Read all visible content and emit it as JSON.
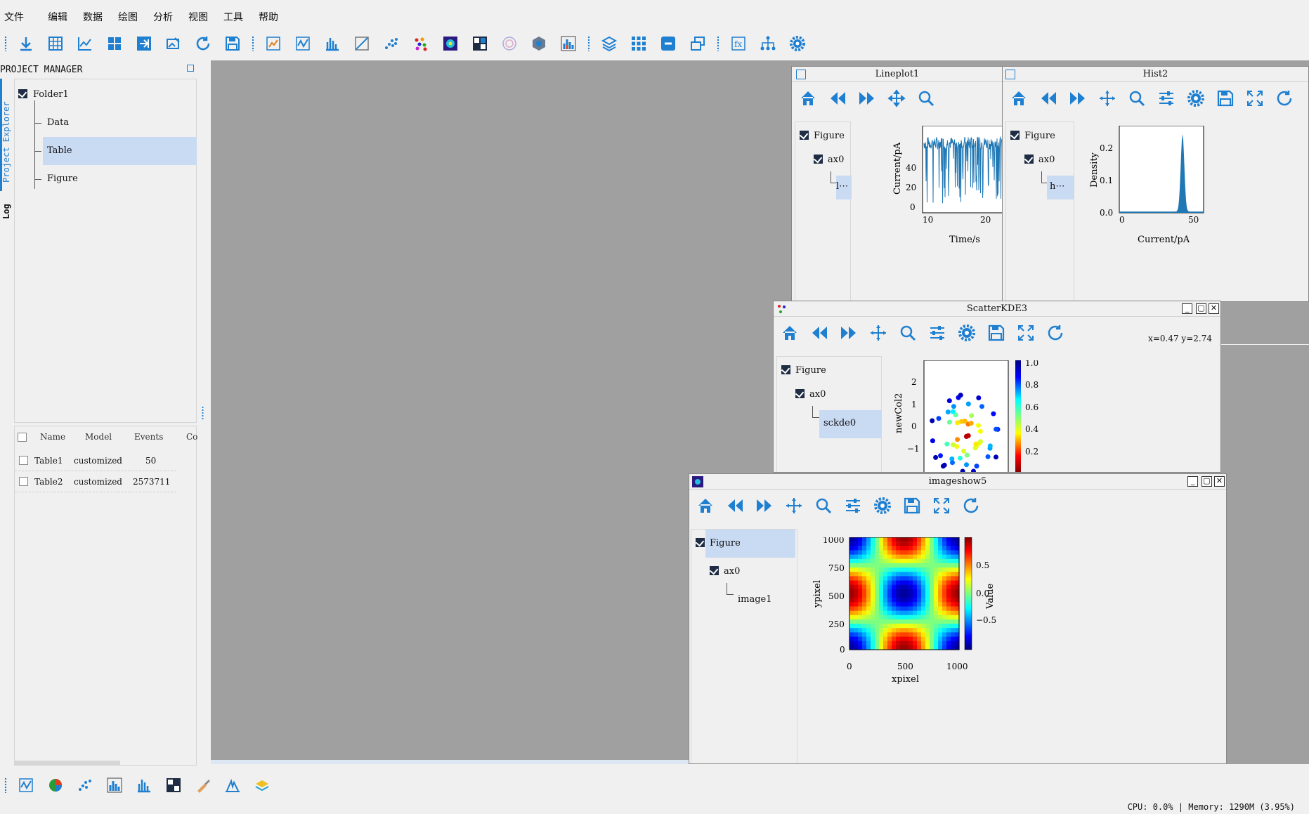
{
  "menu": [
    "文件",
    "编辑",
    "数据",
    "绘图",
    "分析",
    "视图",
    "工具",
    "帮助"
  ],
  "project_manager": {
    "title": "PROJECT MANAGER",
    "tabs": [
      "Project Explorer",
      "Log"
    ],
    "tree": {
      "root": "Folder1",
      "children": [
        "Data",
        "Table",
        "Figure"
      ],
      "selected": "Table"
    }
  },
  "table": {
    "headers": [
      "Name",
      "Model",
      "Events",
      "Co"
    ],
    "rows": [
      {
        "name": "Table1",
        "model": "customized",
        "events": "50"
      },
      {
        "name": "Table2",
        "model": "customized",
        "events": "2573711"
      }
    ]
  },
  "windows": {
    "lineplot": {
      "title": "Lineplot1",
      "tree": [
        "Figure",
        "ax0",
        "l⋯"
      ],
      "chart": {
        "xlabel": "Time/s",
        "ylabel": "Current/pA",
        "xticks": [
          "10",
          "20"
        ],
        "yticks": [
          "0",
          "20",
          "40"
        ]
      }
    },
    "hist": {
      "title": "Hist2",
      "tree": [
        "Figure",
        "ax0",
        "h⋯"
      ],
      "chart": {
        "xlabel": "Current/pA",
        "ylabel": "Density",
        "xticks": [
          "0",
          "50"
        ],
        "yticks": [
          "0.0",
          "0.1",
          "0.2"
        ]
      }
    },
    "scatter": {
      "title": "ScatterKDE3",
      "coords": "x=0.47 y=2.74",
      "tree": [
        "Figure",
        "ax0",
        "sckde0"
      ],
      "chart": {
        "ylabel": "newCol2",
        "yticks": [
          "2",
          "1",
          "0",
          "−1"
        ],
        "cbticks": [
          "1.0",
          "0.8",
          "0.6",
          "0.4",
          "0.2"
        ]
      }
    },
    "image": {
      "title": "imageshow5",
      "tree": [
        "Figure",
        "ax0",
        "image1"
      ],
      "chart": {
        "xlabel": "xpixel",
        "ylabel": "ypixel",
        "xticks": [
          "0",
          "500",
          "1000"
        ],
        "yticks": [
          "1000",
          "750",
          "500",
          "250",
          "0"
        ],
        "cblabel": "Value",
        "cbticks": [
          "0.5",
          "0.0",
          "−0.5"
        ]
      }
    }
  },
  "status": "CPU: 0.0% | Memory: 1290M (3.95%)",
  "colors": {
    "accent": "#1f7fd0",
    "selection": "#c9daf3",
    "mdi": "#a0a0a0"
  }
}
